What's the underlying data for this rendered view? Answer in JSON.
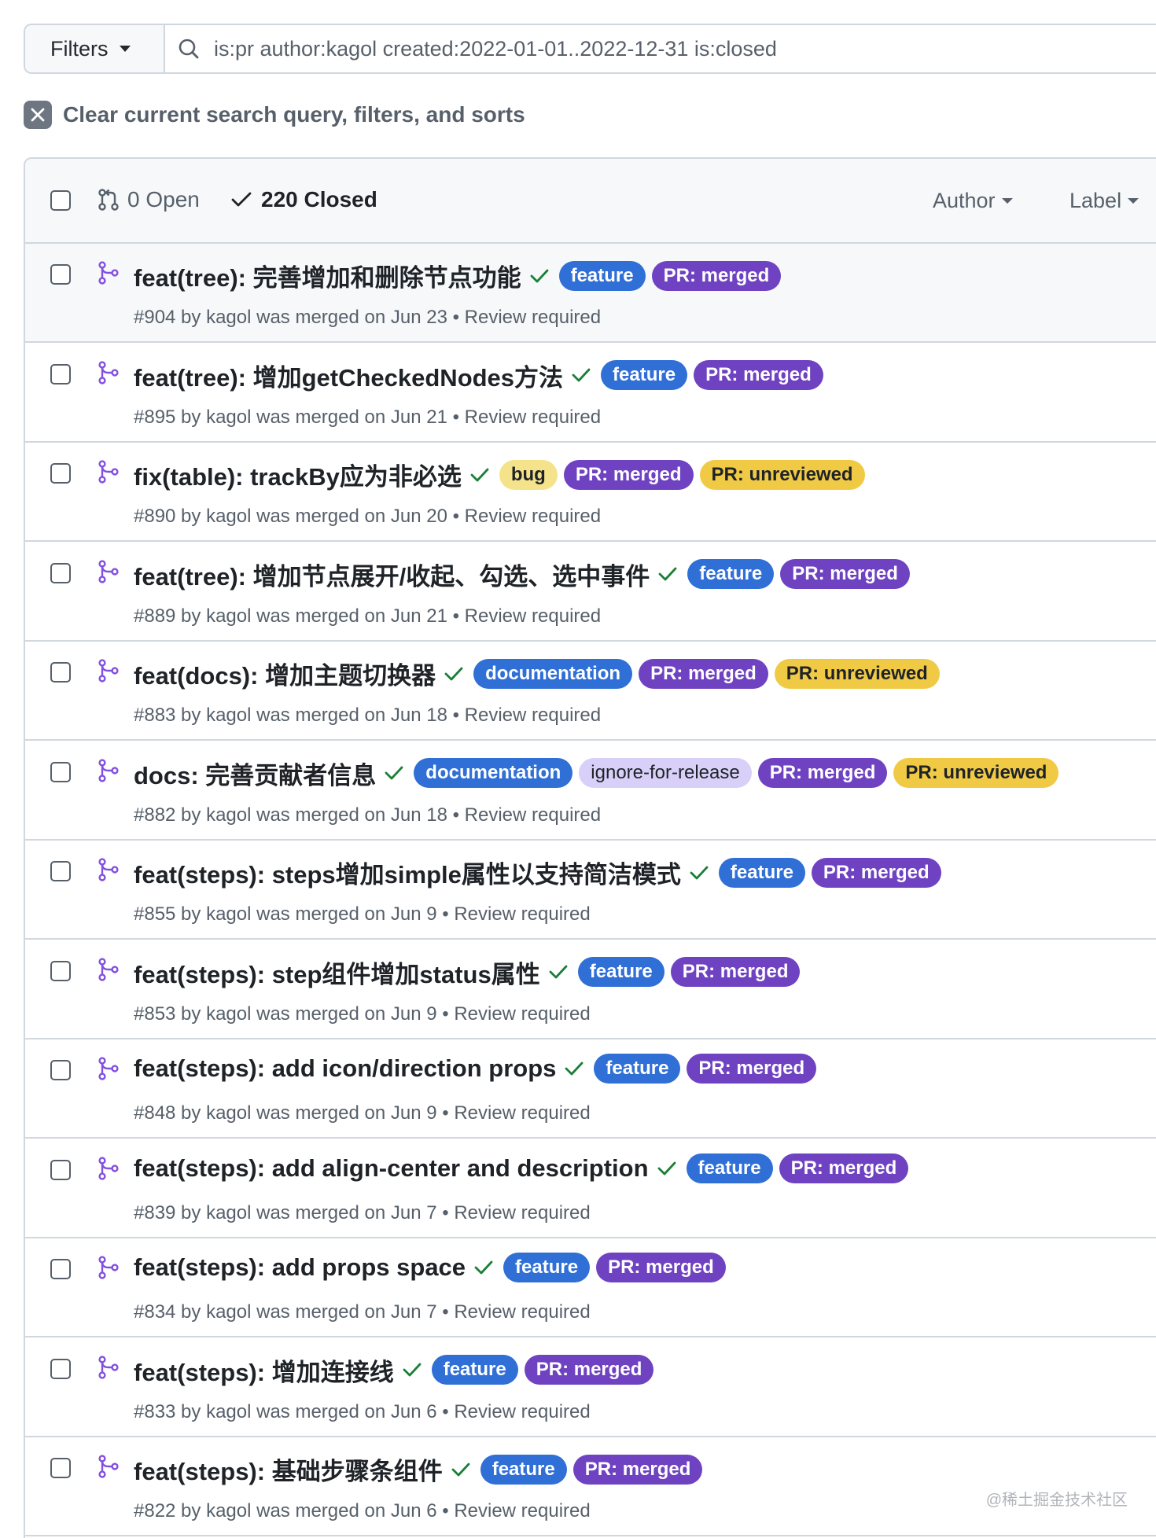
{
  "search": {
    "filters_label": "Filters",
    "query": "is:pr author:kagol created:2022-01-01..2022-12-31 is:closed"
  },
  "clear": {
    "text": "Clear current search query, filters, and sorts"
  },
  "header": {
    "open_label": "0 Open",
    "closed_label": "220 Closed",
    "author_label": "Author",
    "label_label": "Label"
  },
  "colors": {
    "feature": "#2f6fd6",
    "merged": "#6f42c1",
    "bug": "#f4e38a",
    "unreviewed": "#f1ca45",
    "ignore": "#d8d0f8",
    "merged_icon": "#8250df",
    "check": "#1a7f37"
  },
  "rows": [
    {
      "title": "feat(tree): 完善增加和删除节点功能",
      "meta": "#904 by kagol was merged on Jun 23 • Review required",
      "labels": [
        {
          "text": "feature",
          "kind": "feature"
        },
        {
          "text": "PR: merged",
          "kind": "merged"
        }
      ]
    },
    {
      "title": "feat(tree): 增加getCheckedNodes方法",
      "meta": "#895 by kagol was merged on Jun 21 • Review required",
      "labels": [
        {
          "text": "feature",
          "kind": "feature"
        },
        {
          "text": "PR: merged",
          "kind": "merged"
        }
      ]
    },
    {
      "title": "fix(table): trackBy应为非必选",
      "meta": "#890 by kagol was merged on Jun 20 • Review required",
      "labels": [
        {
          "text": "bug",
          "kind": "bug"
        },
        {
          "text": "PR: merged",
          "kind": "merged"
        },
        {
          "text": "PR: unreviewed",
          "kind": "unreviewed"
        }
      ]
    },
    {
      "title": "feat(tree): 增加节点展开/收起、勾选、选中事件",
      "meta": "#889 by kagol was merged on Jun 21 • Review required",
      "labels": [
        {
          "text": "feature",
          "kind": "feature"
        },
        {
          "text": "PR: merged",
          "kind": "merged"
        }
      ]
    },
    {
      "title": "feat(docs): 增加主题切换器",
      "meta": "#883 by kagol was merged on Jun 18 • Review required",
      "labels": [
        {
          "text": "documentation",
          "kind": "documentation"
        },
        {
          "text": "PR: merged",
          "kind": "merged"
        },
        {
          "text": "PR: unreviewed",
          "kind": "unreviewed"
        }
      ]
    },
    {
      "title": "docs: 完善贡献者信息",
      "meta": "#882 by kagol was merged on Jun 18 • Review required",
      "labels": [
        {
          "text": "documentation",
          "kind": "documentation"
        },
        {
          "text": "ignore-for-release",
          "kind": "ignore"
        },
        {
          "text": "PR: merged",
          "kind": "merged"
        },
        {
          "text": "PR: unreviewed",
          "kind": "unreviewed"
        }
      ]
    },
    {
      "title": "feat(steps): steps增加simple属性以支持简洁模式",
      "meta": "#855 by kagol was merged on Jun 9 • Review required",
      "labels": [
        {
          "text": "feature",
          "kind": "feature"
        },
        {
          "text": "PR: merged",
          "kind": "merged"
        }
      ]
    },
    {
      "title": "feat(steps): step组件增加status属性",
      "meta": "#853 by kagol was merged on Jun 9 • Review required",
      "labels": [
        {
          "text": "feature",
          "kind": "feature"
        },
        {
          "text": "PR: merged",
          "kind": "merged"
        }
      ]
    },
    {
      "title": "feat(steps): add icon/direction props",
      "meta": "#848 by kagol was merged on Jun 9 • Review required",
      "labels": [
        {
          "text": "feature",
          "kind": "feature"
        },
        {
          "text": "PR: merged",
          "kind": "merged"
        }
      ]
    },
    {
      "title": "feat(steps): add align-center and description",
      "meta": "#839 by kagol was merged on Jun 7 • Review required",
      "labels": [
        {
          "text": "feature",
          "kind": "feature"
        },
        {
          "text": "PR: merged",
          "kind": "merged"
        }
      ]
    },
    {
      "title": "feat(steps): add props space",
      "meta": "#834 by kagol was merged on Jun 7 • Review required",
      "labels": [
        {
          "text": "feature",
          "kind": "feature"
        },
        {
          "text": "PR: merged",
          "kind": "merged"
        }
      ]
    },
    {
      "title": "feat(steps): 增加连接线",
      "meta": "#833 by kagol was merged on Jun 6 • Review required",
      "labels": [
        {
          "text": "feature",
          "kind": "feature"
        },
        {
          "text": "PR: merged",
          "kind": "merged"
        }
      ]
    },
    {
      "title": "feat(steps): 基础步骤条组件",
      "meta": "#822 by kagol was merged on Jun 6 • Review required",
      "labels": [
        {
          "text": "feature",
          "kind": "feature"
        },
        {
          "text": "PR: merged",
          "kind": "merged"
        }
      ]
    }
  ],
  "watermark": "@稀土掘金技术社区"
}
